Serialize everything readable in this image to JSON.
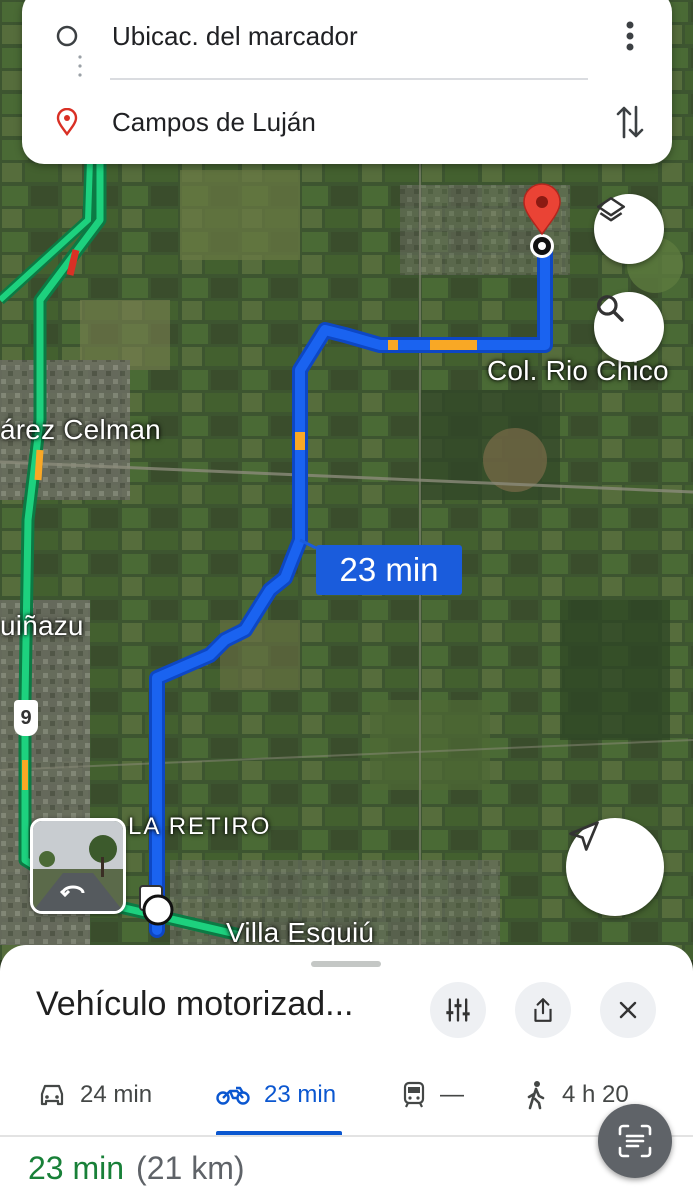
{
  "route_inputs": {
    "origin": "Ubicac. del marcador",
    "destination": "Campos de Luján",
    "menu_icon": "more-vert-icon",
    "swap_icon": "swap-vertical-icon"
  },
  "map": {
    "labels": {
      "col_rio_chico": "Col. Rio Chico",
      "juarez_celman": "árez Celman",
      "guinazu": "uiñazu",
      "la_retiro": "LA RETIRO",
      "villa_esquiu": "Villa Esquiú"
    },
    "route_shield": "9",
    "eta_badge": "23 min",
    "colors": {
      "route": "#1a73e8",
      "route_dark": "#0d47c4",
      "traffic_slow": "#f9a825",
      "highway": "#1dd17e",
      "destination_pin": "#ea4335"
    }
  },
  "floating_buttons": {
    "layers": "layers-icon",
    "search": "search-icon",
    "navigate": "navigation-arrow-icon"
  },
  "bottom_sheet": {
    "title": "Vehículo motorizad...",
    "modes": [
      {
        "icon": "car-icon",
        "label": "24 min",
        "active": false
      },
      {
        "icon": "motorcycle-icon",
        "label": "23 min",
        "active": true
      },
      {
        "icon": "transit-icon",
        "label": "—",
        "active": false
      },
      {
        "icon": "walk-icon",
        "label": "4 h 20",
        "active": false
      }
    ],
    "summary_duration": "23 min",
    "summary_distance": "(21 km)"
  }
}
